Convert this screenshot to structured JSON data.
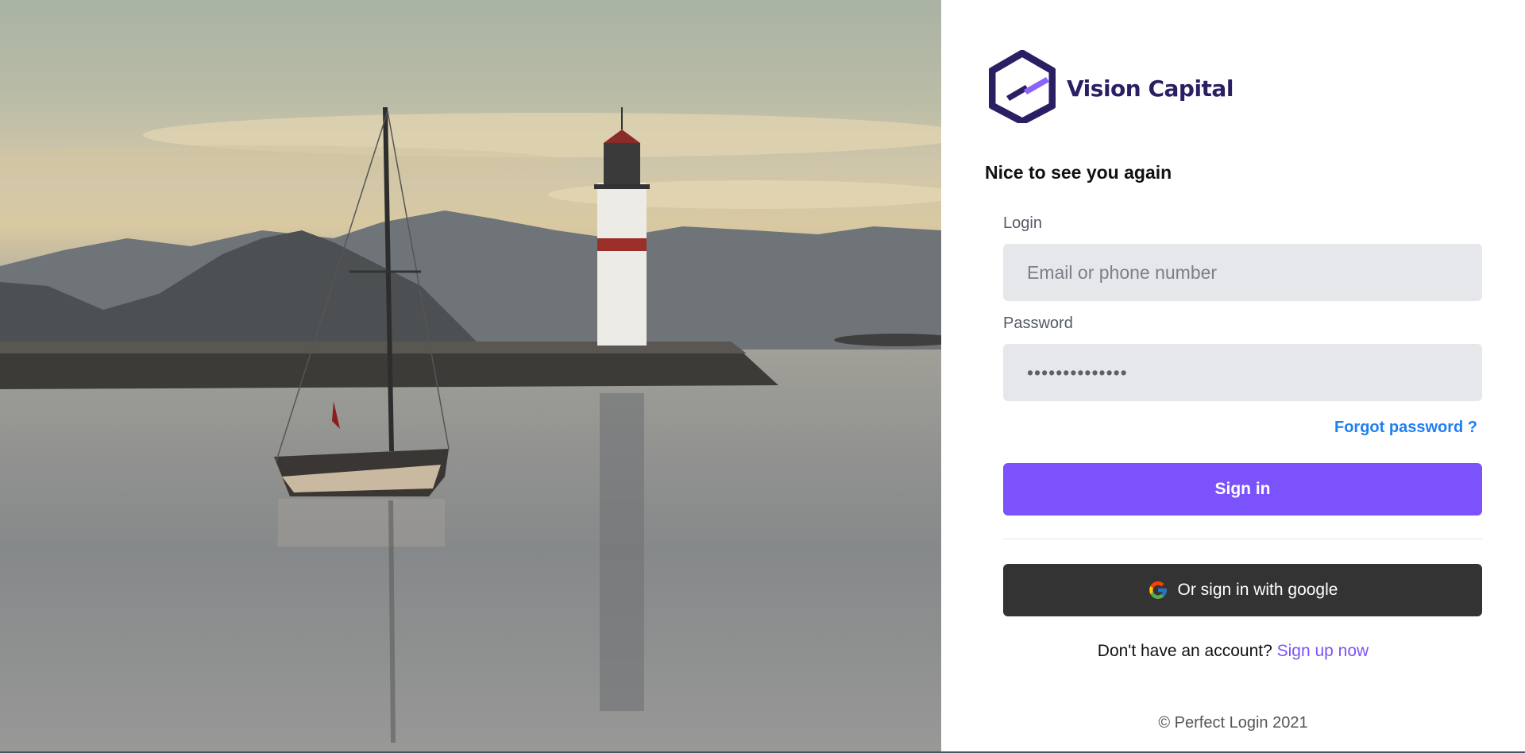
{
  "brand": {
    "name": "Vision Capital"
  },
  "hero": {
    "image": "sailboat-lighthouse-sunset-photo"
  },
  "form": {
    "greeting": "Nice to see you again",
    "login_label": "Login",
    "login_placeholder": "Email or phone number",
    "password_label": "Password",
    "password_value": "••••••••••••••",
    "forgot_label": "Forgot password ?",
    "signin_label": "Sign in",
    "google_label": "Or sign in with google",
    "no_account_text": "Don't have an account?",
    "signup_label": "Sign up now"
  },
  "footer": {
    "text": "© Perfect Login 2021"
  },
  "colors": {
    "accent": "#7c52fb",
    "link": "#1d7ff3",
    "google_button": "#333333",
    "brand_dark": "#2b1f63"
  },
  "icons": [
    "vision-capital-logo-icon",
    "google-icon"
  ]
}
